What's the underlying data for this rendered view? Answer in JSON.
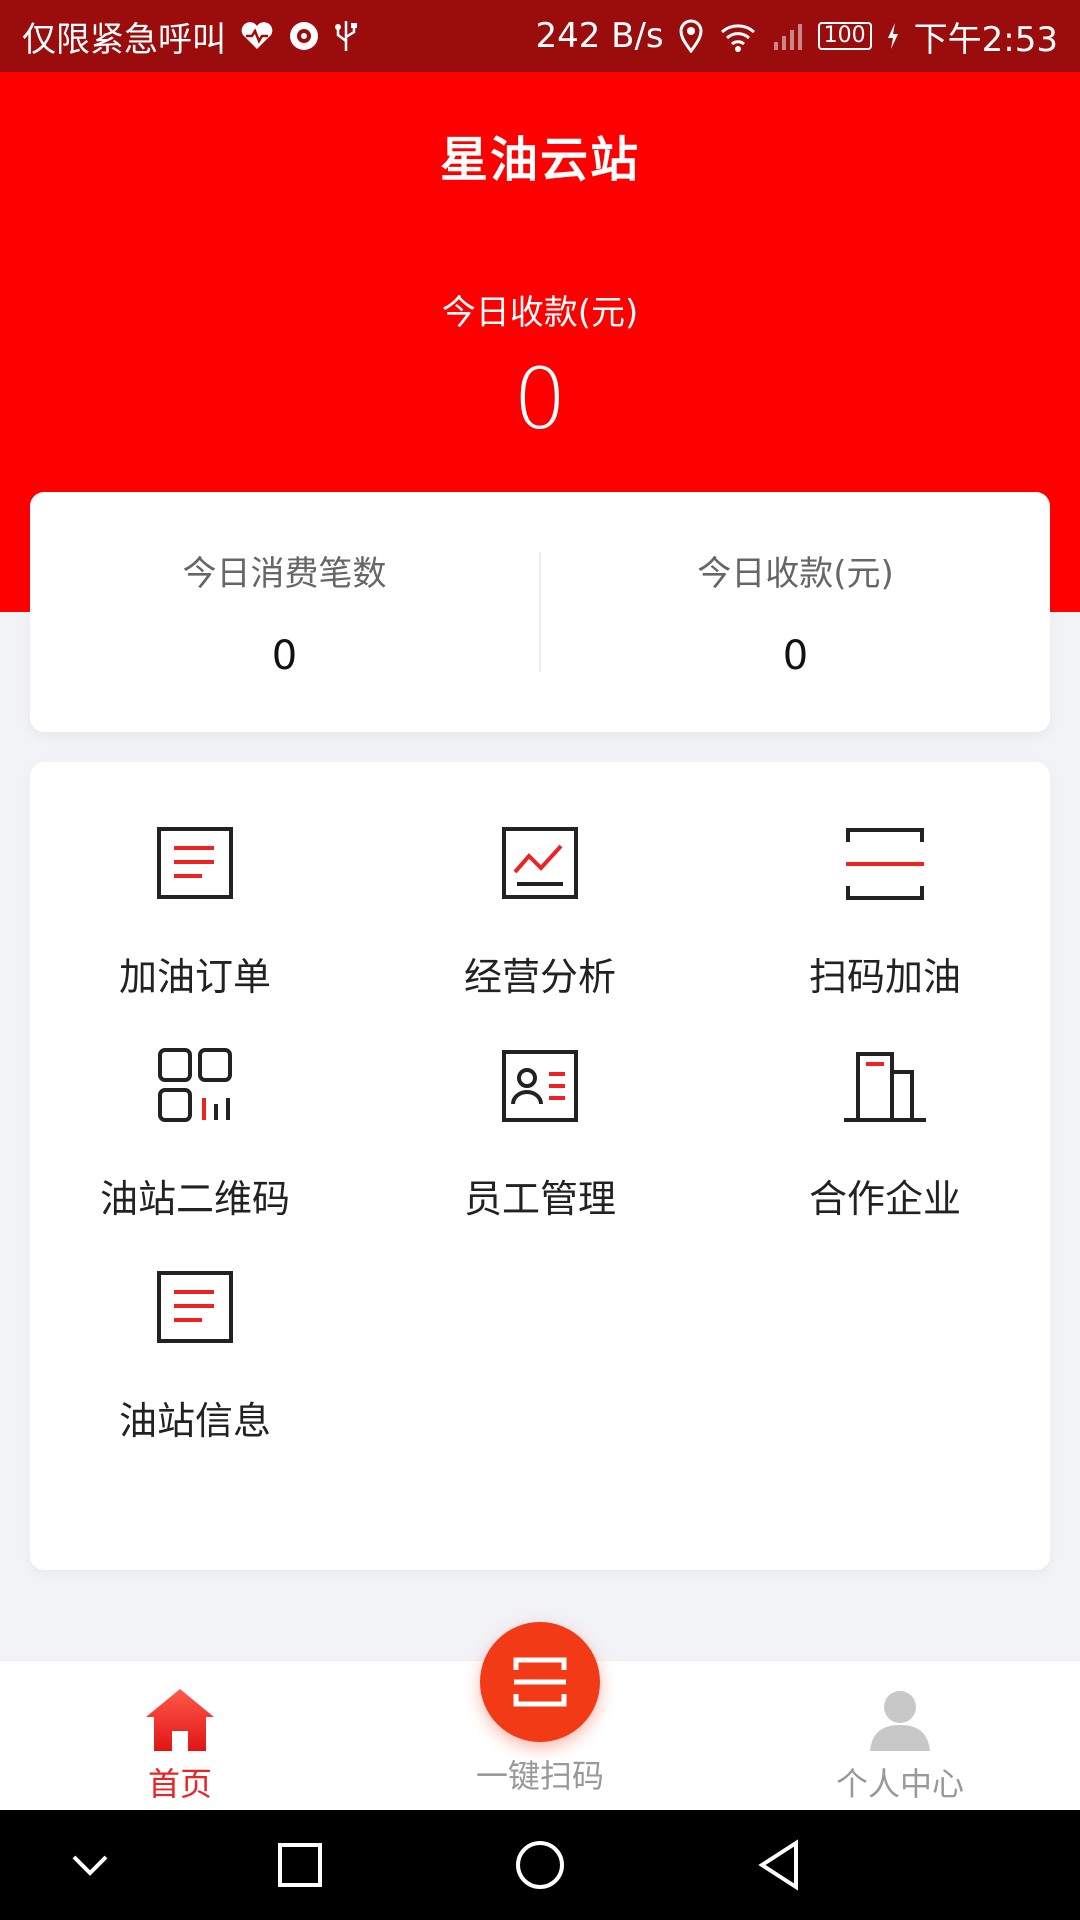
{
  "status_bar": {
    "left_text": "仅限紧急呼叫",
    "speed": "242 B/s",
    "battery": "100",
    "time": "下午2:53"
  },
  "header": {
    "title": "星油云站",
    "today_receipts_label": "今日收款(元)",
    "today_receipts_value": "0"
  },
  "stats": {
    "consume_label": "今日消费笔数",
    "consume_value": "0",
    "receipt_label": "今日收款(元)",
    "receipt_value": "0"
  },
  "menu": {
    "items": [
      {
        "label": "加油订单",
        "icon": "document-lines-icon"
      },
      {
        "label": "经营分析",
        "icon": "line-chart-icon"
      },
      {
        "label": "扫码加油",
        "icon": "scan-frame-icon"
      },
      {
        "label": "油站二维码",
        "icon": "qr-code-icon"
      },
      {
        "label": "员工管理",
        "icon": "id-card-icon"
      },
      {
        "label": "合作企业",
        "icon": "building-icon"
      },
      {
        "label": "油站信息",
        "icon": "document-lines-icon"
      }
    ]
  },
  "bottom_nav": {
    "home": "首页",
    "scan": "一键扫码",
    "me": "个人中心"
  },
  "colors": {
    "brand_red": "#ff0000",
    "status_bar": "#9b0d0d",
    "fab": "#f23a17",
    "active_tab": "#e22222",
    "inactive_tab": "#999999"
  }
}
